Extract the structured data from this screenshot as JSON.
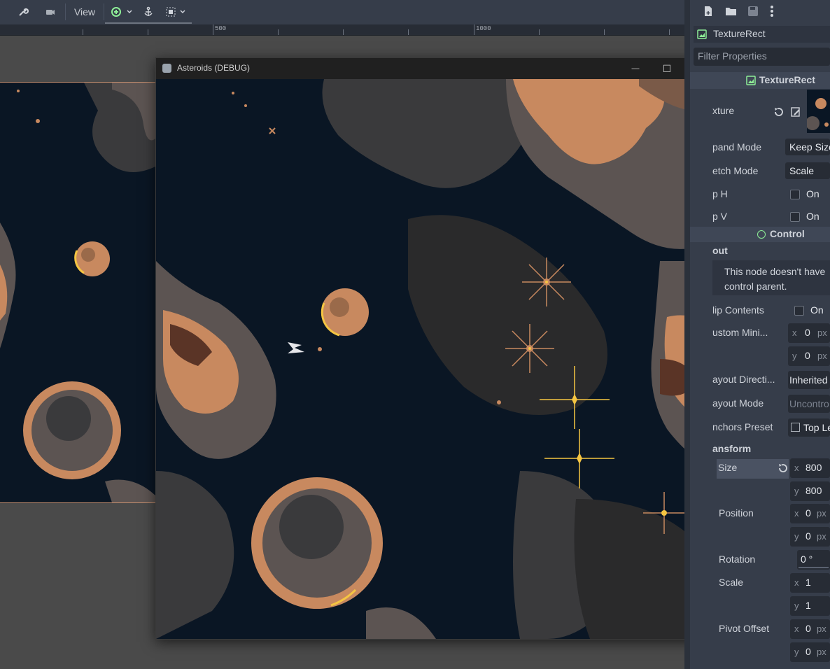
{
  "toolbar": {
    "view_label": "View"
  },
  "ruler": {
    "labels": [
      "500",
      "1000"
    ]
  },
  "debug_window": {
    "title": "Asteroids (DEBUG)",
    "minimize": "—",
    "maximize": "☐",
    "close": "✕"
  },
  "inspector": {
    "node_name": "TextureRect",
    "filter_placeholder": "Filter Properties",
    "class_header": "TextureRect",
    "texture_label": "xture",
    "expand_mode_label": "pand Mode",
    "expand_mode_value": "Keep Size",
    "stretch_mode_label": "etch Mode",
    "stretch_mode_value": "Scale",
    "flip_h_label": "p H",
    "flip_h_value": "On",
    "flip_v_label": "p V",
    "flip_v_value": "On",
    "control_header": "Control",
    "layout_header": "out",
    "warning_line1": "This node doesn't have",
    "warning_line2": "control parent.",
    "clip_contents_label": "lip Contents",
    "clip_contents_value": "On",
    "custom_min_label": "ustom Mini...",
    "custom_min_x": "0",
    "custom_min_y": "0",
    "layout_direction_label": "ayout Directi...",
    "layout_direction_value": "Inherited",
    "layout_mode_label": "ayout Mode",
    "layout_mode_value": "Uncontro",
    "anchors_preset_label": "nchors Preset",
    "anchors_preset_value": "Top Le",
    "transform_header": "ansform",
    "size_label": "Size",
    "size_x": "800",
    "size_y": "800",
    "position_label": "Position",
    "position_x": "0",
    "position_y": "0",
    "rotation_label": "Rotation",
    "rotation_value": "0 °",
    "scale_label": "Scale",
    "scale_x": "1",
    "scale_y": "1",
    "pivot_label": "Pivot Offset",
    "pivot_x": "0",
    "pivot_y": "0",
    "axis_x": "x",
    "axis_y": "y",
    "unit_px": "px"
  },
  "colors": {
    "editor_bg": "#363d4a",
    "space": "#0a1624",
    "rock_light": "#c8895f",
    "rock_mid": "#5c5452",
    "rock_dark": "#3a3a3c",
    "star": "#f5c542",
    "accent_green": "#8eef97"
  }
}
